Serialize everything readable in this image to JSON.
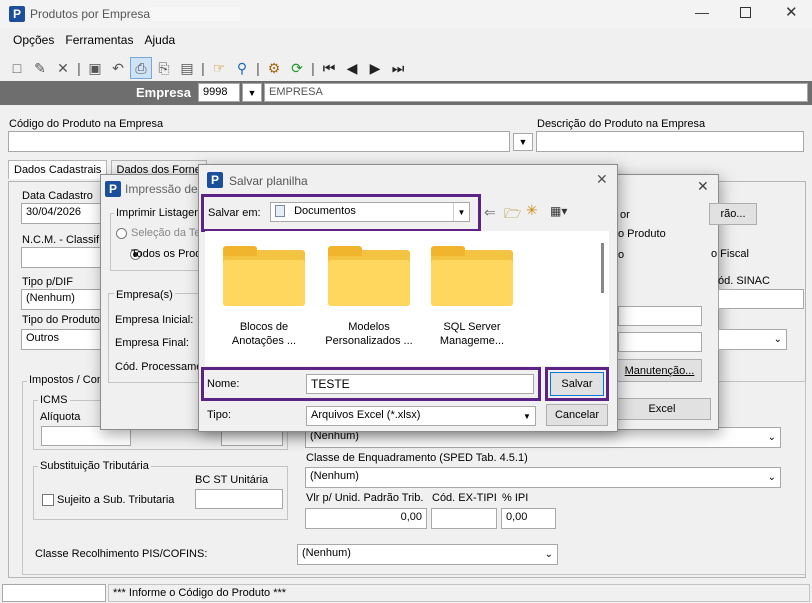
{
  "window": {
    "title": "Produtos por Empresa"
  },
  "menu": [
    "Opções",
    "Ferramentas",
    "Ajuda"
  ],
  "empresa": {
    "label": "Empresa",
    "code": "9998",
    "name": "EMPRESA"
  },
  "product": {
    "code_label": "Código do Produto na Empresa",
    "desc_label": "Descrição do Produto na Empresa"
  },
  "tabs": [
    "Dados Cadastrais",
    "Dados dos Forne"
  ],
  "form": {
    "data_cadastro_label": "Data Cadastro",
    "data_cadastro_value": "30/04/2026",
    "ncm_label": "N.C.M. - Classif",
    "tipo_dif_label": "Tipo p/DIF",
    "tipo_dif_value": "(Nenhum)",
    "tipo_produto_label": "Tipo do Produto",
    "tipo_produto_value": "Outros",
    "impostos_label": "Impostos / Con",
    "icms_label": "ICMS",
    "aliquota_label": "Alíquota",
    "subst_label": "Substituição Tributária",
    "bc_st_label": "BC ST Unitária",
    "sujeito_label": "Sujeito a Sub. Tributaria",
    "classe_pis_label": "Classe Recolhimento PIS/COFINS:",
    "classe_pis_value": "(Nenhum)",
    "right_combo1_value": "(Nenhum)",
    "classe_enq_label": "Classe de Enquadramento (SPED Tab. 4.5.1)",
    "classe_enq_value": "(Nenhum)",
    "vlr_label": "Vlr p/ Unid. Padrão Trib.",
    "vlr_value": "0,00",
    "cod_extipi_label": "Cód. EX-TIPI",
    "ipi_label": "% IPI",
    "ipi_value": "0,00",
    "right_btn1": "rão...",
    "right_text1": "or",
    "right_text2": "o Produto",
    "right_text3": "o",
    "right_text4": "o Fiscal",
    "right_text5": "ód. SINAC",
    "manutencao_btn": "Manutenção...",
    "excel_btn": "Excel"
  },
  "print_dialog": {
    "title": "Impressão de",
    "imprimir_label": "Imprimir Listagem",
    "opt1": "Seleção da Te",
    "opt2": "Todos os Prod",
    "empresas_label": "Empresa(s)",
    "empresa_inicial": "Empresa Inicial:",
    "empresa_final": "Empresa Final:",
    "cod_processamento": "Cód. Processame"
  },
  "save_dialog": {
    "title": "Salvar planilha",
    "salvar_em_label": "Salvar em:",
    "location": "Documentos",
    "folders": [
      {
        "name": "Blocos de Anotações ..."
      },
      {
        "name": "Modelos Personalizados ..."
      },
      {
        "name": "SQL Server Manageme..."
      }
    ],
    "nome_label": "Nome:",
    "nome_value": "TESTE",
    "tipo_label": "Tipo:",
    "tipo_value": "Arquivos Excel (*.xlsx)",
    "salvar_btn": "Salvar",
    "cancelar_btn": "Cancelar"
  },
  "status": {
    "message": "*** Informe o Código do Produto ***"
  },
  "colors": {
    "accent": "#5b2386",
    "empresa_bar": "#6e6e6e"
  }
}
